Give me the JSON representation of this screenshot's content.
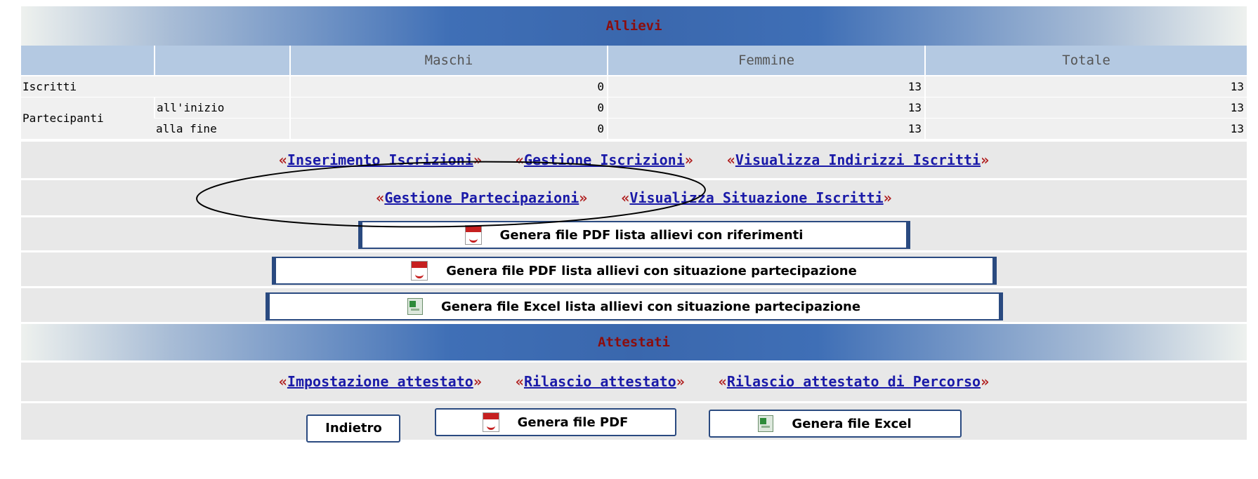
{
  "allievi_title": "Allievi",
  "table": {
    "headers": [
      "",
      "",
      "Maschi",
      "Femmine",
      "Totale"
    ],
    "iscritti": {
      "label": "Iscritti",
      "values": [
        "0",
        "13",
        "13"
      ]
    },
    "partecipanti": {
      "label": "Partecipanti",
      "rows": [
        {
          "sub": "all'inizio",
          "values": [
            "0",
            "13",
            "13"
          ]
        },
        {
          "sub": "alla fine",
          "values": [
            "0",
            "13",
            "13"
          ]
        }
      ]
    }
  },
  "links_row1": [
    "Inserimento Iscrizioni",
    "Gestione Iscrizioni",
    "Visualizza Indirizzi Iscritti"
  ],
  "links_row2": [
    "Gestione Partecipazioni",
    "Visualizza Situazione Iscritti"
  ],
  "buttons": {
    "pdf_riferimenti": "Genera file PDF lista allievi con riferimenti",
    "pdf_partecipazione": "Genera file PDF lista allievi con situazione partecipazione",
    "excel_partecipazione": "Genera file Excel lista allievi con situazione partecipazione"
  },
  "attestati_title": "Attestati",
  "attestati_links": [
    "Impostazione attestato",
    "Rilascio attestato",
    "Rilascio attestato di Percorso"
  ],
  "bottom": {
    "back": "Indietro",
    "pdf": "Genera file PDF",
    "excel": "Genera file Excel"
  },
  "guillemet_open": "«",
  "guillemet_close": "»",
  "colors": {
    "banner": "#3a67ad",
    "title": "#8b0d0d",
    "link": "#1a1aa8",
    "header": "#b4c9e2",
    "guillemet": "#b02020"
  },
  "icons": [
    "pdf-file-icon",
    "excel-file-icon"
  ]
}
